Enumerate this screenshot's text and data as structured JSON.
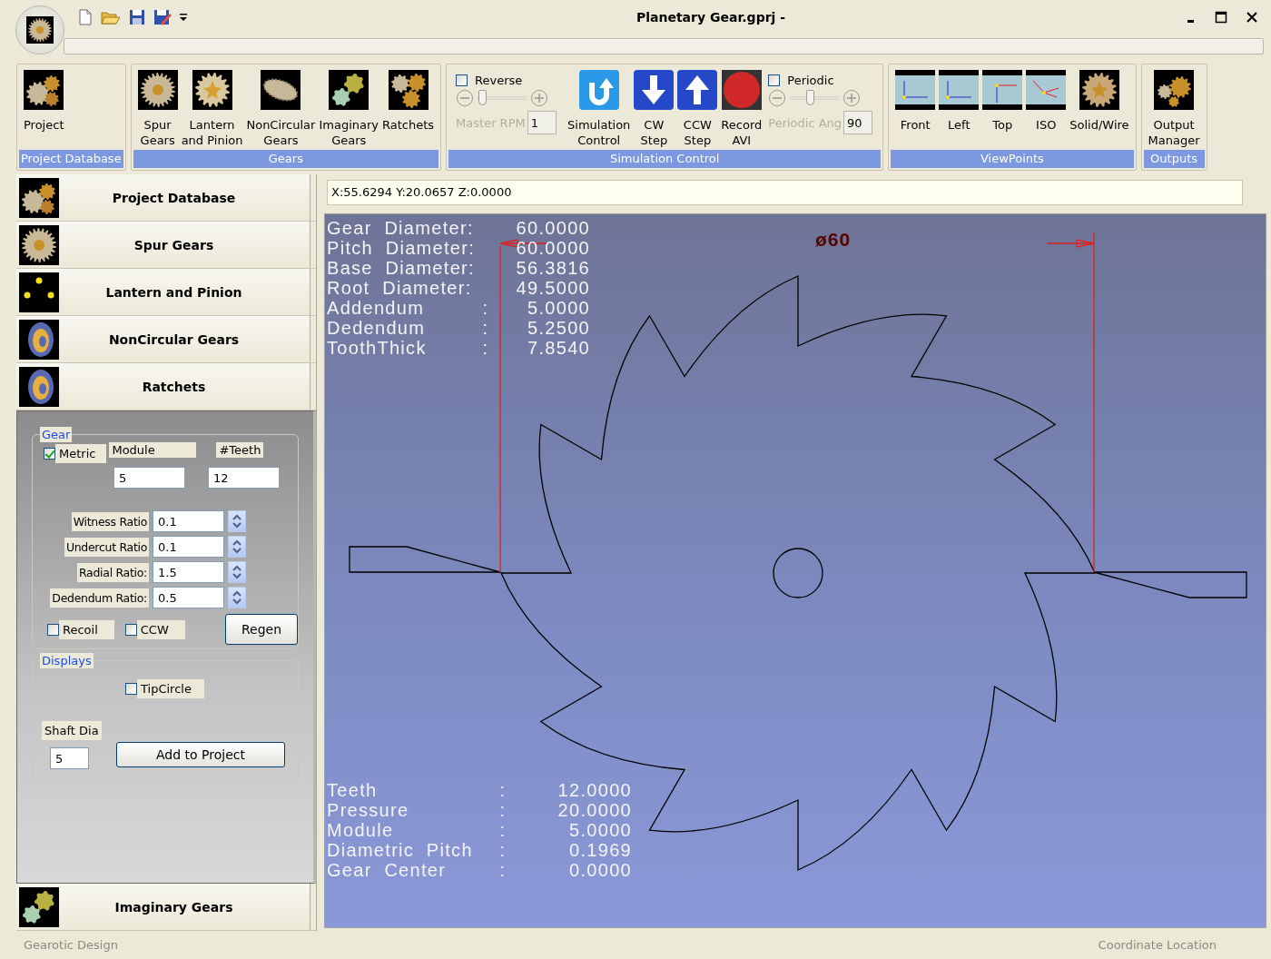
{
  "window": {
    "title": "Planetary Gear.gprj -"
  },
  "ribbon": {
    "groups": [
      {
        "label": "Project Database",
        "items": [
          {
            "kind": "button",
            "label": "Project"
          }
        ]
      },
      {
        "label": "Gears",
        "items": [
          {
            "kind": "button",
            "label": "Spur\nGears"
          },
          {
            "kind": "button",
            "label": "Lantern\nand Pinion"
          },
          {
            "kind": "button",
            "label": "NonCircular\nGears"
          },
          {
            "kind": "button",
            "label": "Imaginary\nGears"
          },
          {
            "kind": "button",
            "label": "Ratchets"
          }
        ]
      },
      {
        "label": "Simulation Control",
        "items": [
          {
            "kind": "slider",
            "checkbox": {
              "label": "Reverse",
              "checked": false
            },
            "level": 0.1,
            "caption": "Master RPM",
            "value": "1"
          },
          {
            "kind": "button",
            "label": "Simulation\nControl"
          },
          {
            "kind": "button",
            "label": "CW\nStep"
          },
          {
            "kind": "button",
            "label": "CCW\nStep"
          },
          {
            "kind": "button",
            "label": "Record\nAVI"
          },
          {
            "kind": "slider",
            "checkbox": {
              "label": "Periodic",
              "checked": false
            },
            "level": 0.4,
            "caption": "Periodic Ang",
            "value": "90"
          }
        ]
      },
      {
        "label": "ViewPoints",
        "items": [
          {
            "kind": "button",
            "label": "Front"
          },
          {
            "kind": "button",
            "label": "Left"
          },
          {
            "kind": "button",
            "label": "Top"
          },
          {
            "kind": "button",
            "label": "ISO"
          },
          {
            "kind": "button",
            "label": "Solid/Wire"
          }
        ]
      },
      {
        "label": "Outputs",
        "items": [
          {
            "kind": "button",
            "label": "Output\nManager"
          }
        ]
      }
    ]
  },
  "sidebar": {
    "items": [
      {
        "label": "Project Database"
      },
      {
        "label": "Spur Gears"
      },
      {
        "label": "Lantern and Pinion"
      },
      {
        "label": "NonCircular Gears"
      },
      {
        "label": "Ratchets"
      }
    ],
    "bottom_items": [
      {
        "label": "Imaginary Gears"
      }
    ],
    "panel": {
      "gear": {
        "title": "Gear",
        "metric": {
          "label": "Metric",
          "checked": true
        },
        "module": {
          "label": "Module",
          "value": "5"
        },
        "teeth": {
          "label": "#Teeth",
          "value": "12"
        },
        "ratios": [
          {
            "label": "Witness Ratio",
            "value": "0.1"
          },
          {
            "label": "Undercut Ratio",
            "value": "0.1"
          },
          {
            "label": "Radial Ratio:",
            "value": "1.5"
          },
          {
            "label": "Dedendum Ratio:",
            "value": "0.5"
          }
        ],
        "options": [
          {
            "label": "Recoil",
            "checked": false
          },
          {
            "label": "CCW",
            "checked": false
          }
        ],
        "button": "Regen"
      },
      "displays": {
        "title": "Displays",
        "options": [
          {
            "label": "TipCircle",
            "checked": false
          }
        ]
      },
      "shaft": {
        "label": "Shaft Dia",
        "value": "5",
        "button": "Add to Project"
      }
    }
  },
  "coordinates": "X:55.6294 Y:20.0657 Z:0.0000",
  "view": {
    "dimension": "ø60",
    "stats_top": [
      {
        "label": "Gear  Diameter:",
        "value": "60.0000"
      },
      {
        "label": "Pitch  Diameter:",
        "value": "60.0000"
      },
      {
        "label": "Base  Diameter:",
        "value": "56.3816"
      },
      {
        "label": "Root  Diameter:",
        "value": "49.5000"
      },
      {
        "label": "Addendum",
        "separator": ":",
        "value": "5.0000"
      },
      {
        "label": "Dedendum",
        "separator": ":",
        "value": "5.2500"
      },
      {
        "label": "ToothThick",
        "separator": ":",
        "value": "7.8540"
      }
    ],
    "stats_bottom": [
      {
        "label": "Teeth",
        "separator": ":",
        "value": "12.0000"
      },
      {
        "label": "Pressure",
        "separator": ":",
        "value": "20.0000"
      },
      {
        "label": "Module",
        "separator": ":",
        "value": "5.0000"
      },
      {
        "label": "Diametric  Pitch",
        "separator": ":",
        "value": "0.1969"
      },
      {
        "label": "Gear  Center",
        "separator": ":",
        "value": "0.0000"
      }
    ]
  },
  "status_bar": {
    "left": "Gearotic Design",
    "right": "Coordinate Location"
  }
}
